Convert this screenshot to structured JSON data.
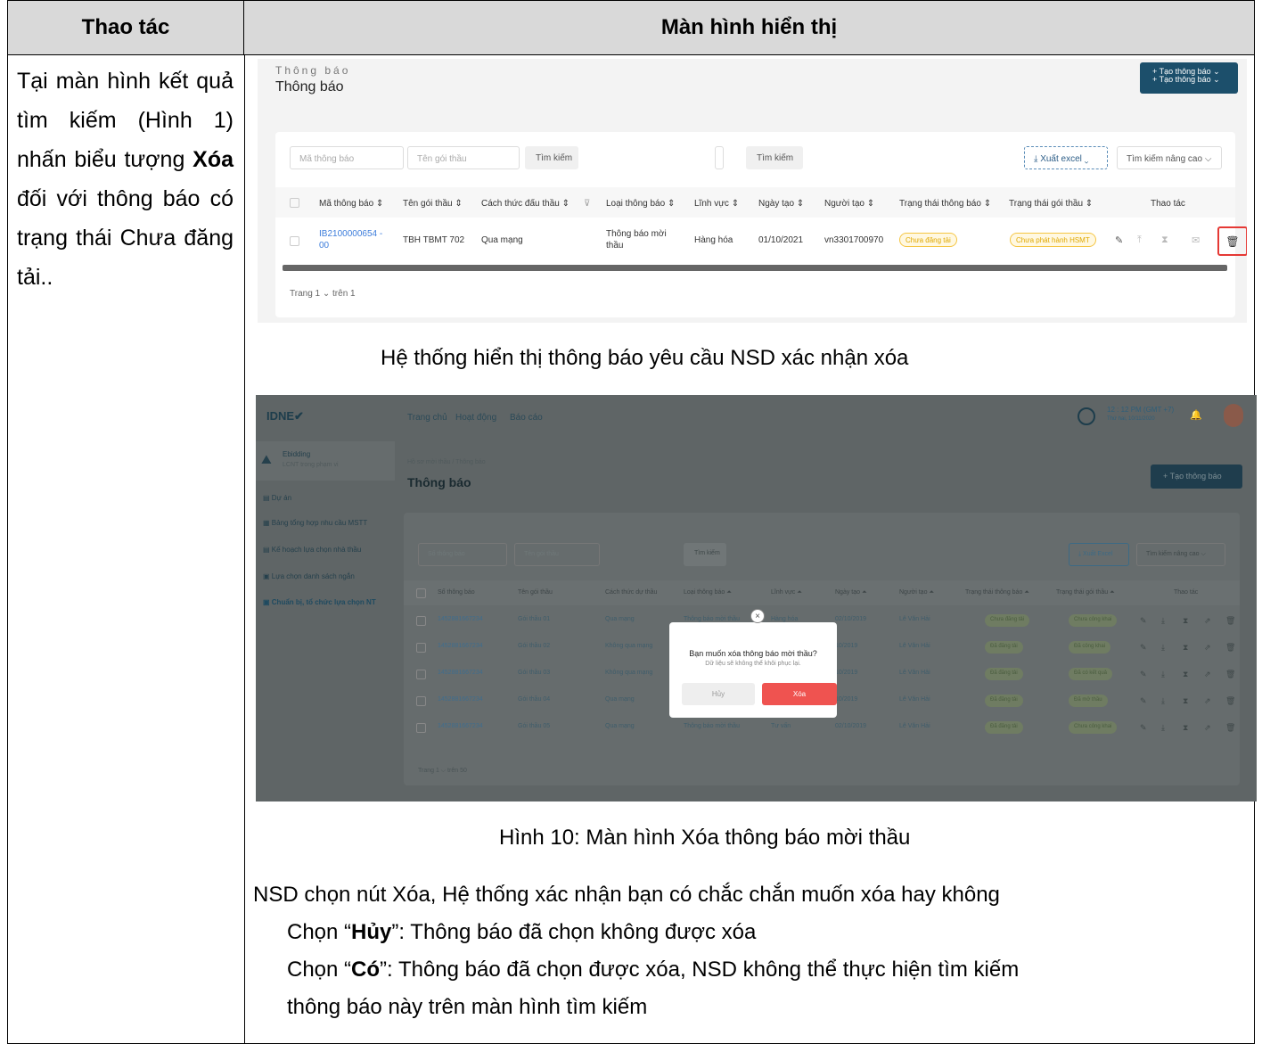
{
  "header": {
    "col1": "Thao tác",
    "col2": "Màn hình hiển thị"
  },
  "left_text": "Tại màn hình kết quả tìm kiếm (Hình 1) nhấn biểu tượng Xóa đối với thông báo có trạng thái Chưa đăng tải..",
  "left_bold": "Xóa",
  "shot1": {
    "ghost": "Thông báo",
    "title": "Thông báo",
    "new_btn_1": "+ Tạo thông báo ⌄",
    "new_btn_2": "+ Tạo thông báo ⌄",
    "ph_code": "Mã thông báo",
    "ph_pkg": "Tên gói thầu",
    "search": "Tìm kiếm",
    "search2": "Tìm kiếm",
    "export": "⤓ Xuất excel ⌄",
    "adv": "Tìm kiếm nâng cao ⌵",
    "cols": [
      "Mã thông báo ⇕",
      "Tên gói thầu ⇕",
      "Cách thức đấu thầu ⇕",
      "Loại thông báo ⇕",
      "Lĩnh vực ⇕",
      "Ngày tạo ⇕",
      "Người tạo ⇕",
      "Trạng thái thông báo ⇕",
      "Trạng thái gói thầu ⇕",
      "Thao tác"
    ],
    "row": {
      "code1": "IB2100000654 -",
      "code2": "00",
      "pkg": "TBH TBMT 702",
      "method": "Qua mạng",
      "type1": "Thông báo mời",
      "type2": "thầu",
      "field": "Hàng hóa",
      "date": "01/10/2021",
      "creator": "vn3301700970",
      "status": "Chưa đăng tải",
      "pkg_status": "Chưa phát hành HSMT"
    },
    "pager": "Trang   1   ⌄   trên 1"
  },
  "caption1": "Hệ thống hiển thị thông báo yêu cầu NSD xác nhận xóa",
  "shot2": {
    "logo": "IDNE✔",
    "nav": [
      "Trang chủ",
      "Hoạt động",
      "Báo cáo"
    ],
    "clock": "12 : 12 PM (GMT +7)",
    "date": "Thứ hai, 10/11/2020",
    "side_top": "Ebidding",
    "side_sub": "LCNT trong phạm vi",
    "side": [
      "Dự án",
      "Bảng tổng hợp nhu cầu MSTT",
      "Kế hoạch lựa chọn nhà thầu",
      "Lựa chọn danh sách ngắn",
      "Chuẩn bị, tổ chức lựa chọn NT"
    ],
    "crumb": "Hồ sơ mời thầu / Thông báo",
    "title": "Thông báo",
    "new_btn": "+ Tạo thông báo",
    "ph1": "Số thông báo",
    "ph2": "Tên gói thầu",
    "search": "Tìm kiếm",
    "export": "⤓ Xuất Excel",
    "adv": "Tìm kiếm nâng cao ⌵",
    "cols": [
      "Số thông báo",
      "Tên gói thầu",
      "Cách thức dự thầu",
      "Loại thông báo ⏶",
      "Lĩnh vực ⏶",
      "Ngày tạo ⏶",
      "Người tạo ⏶",
      "Trạng thái thông báo ⏶",
      "Trạng thái gói thầu ⏶",
      "Thao tác"
    ],
    "rows": [
      {
        "id": "1452881667234",
        "pkg": "Gói thầu 01",
        "m": "Qua mạng",
        "t": "Thông báo mời thầu",
        "f": "Hàng hóa",
        "d": "02/10/2019",
        "u": "Lê Văn Hải",
        "s": "Chưa đăng tải",
        "p": "Chưa công khai"
      },
      {
        "id": "1452881667234",
        "pkg": "Gói thầu 02",
        "m": "Không qua mạng",
        "t": "",
        "f": "",
        "d": "10/2019",
        "u": "Lê Văn Hải",
        "s": "Đã đăng tải",
        "p": "Đã công khai"
      },
      {
        "id": "1452881667234",
        "pkg": "Gói thầu 03",
        "m": "Không qua mạng",
        "t": "",
        "f": "",
        "d": "10/2019",
        "u": "Lê Văn Hải",
        "s": "Đã đăng tải",
        "p": "Đã có kết quả"
      },
      {
        "id": "1452881667234",
        "pkg": "Gói thầu 04",
        "m": "Qua mạng",
        "t": "",
        "f": "",
        "d": "10/2019",
        "u": "Lê Văn Hải",
        "s": "Đã đăng tải",
        "p": "Đã mở thầu"
      },
      {
        "id": "1452881667234",
        "pkg": "Gói thầu 05",
        "m": "Qua mạng",
        "t": "Thông báo mời thầu",
        "f": "Tư vấn",
        "d": "02/10/2019",
        "u": "Lê Văn Hải",
        "s": "Đã đăng tải",
        "p": "Chưa công khai"
      }
    ],
    "pager": "Trang  1 ⌵  trên 50",
    "modal": {
      "q": "Bạn muốn xóa thông báo mời thầu?",
      "s": "Dữ liệu sẽ không thể khôi phục lại.",
      "cancel": "Hủy",
      "ok": "Xóa"
    }
  },
  "caption2": "Hình 10: Màn hình Xóa thông báo mời thầu",
  "para": {
    "l1": "NSD chọn nút Xóa, Hệ thống xác nhận bạn có chắc chắn muốn xóa hay không",
    "l2a": "Chọn “",
    "l2b": "Hủy",
    "l2c": "”: Thông báo đã chọn không được xóa",
    "l3a": "Chọn “",
    "l3b": "Có",
    "l3c": "”: Thông báo đã chọn được xóa, NSD không thể thực hiện tìm kiếm",
    "l4": "thông báo này trên màn hình tìm kiếm"
  }
}
